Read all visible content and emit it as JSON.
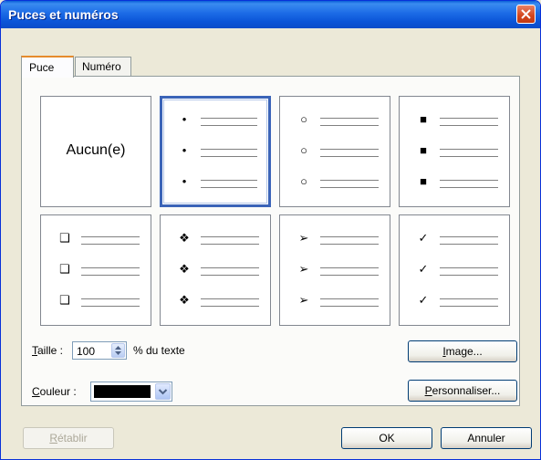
{
  "window": {
    "title": "Puces et numéros",
    "close_label": "×"
  },
  "tabs": [
    {
      "label": "Puce",
      "active": true
    },
    {
      "label": "Numéro",
      "active": false
    }
  ],
  "bullets": [
    {
      "id": "none",
      "label": "Aucun(e)",
      "glyph": ""
    },
    {
      "id": "filled-dot",
      "glyph": "•",
      "selected": true
    },
    {
      "id": "hollow-circle",
      "glyph": "○"
    },
    {
      "id": "filled-square",
      "glyph": "■"
    },
    {
      "id": "hollow-square",
      "glyph": "❑"
    },
    {
      "id": "four-diamonds",
      "glyph": "❖"
    },
    {
      "id": "arrowhead",
      "glyph": "➢"
    },
    {
      "id": "checkmark",
      "glyph": "✓"
    }
  ],
  "size": {
    "label_prefix": "T",
    "label_rest": "aille :",
    "value": "100",
    "suffix": "% du texte"
  },
  "color": {
    "label_prefix": "C",
    "label_rest": "ouleur :",
    "value": "#000000"
  },
  "buttons": {
    "image": {
      "prefix": "I",
      "rest": "mage..."
    },
    "customize": {
      "prefix": "P",
      "rest": "ersonnaliser..."
    },
    "reset": {
      "prefix": "R",
      "rest": "établir"
    },
    "ok": "OK",
    "cancel": "Annuler"
  }
}
